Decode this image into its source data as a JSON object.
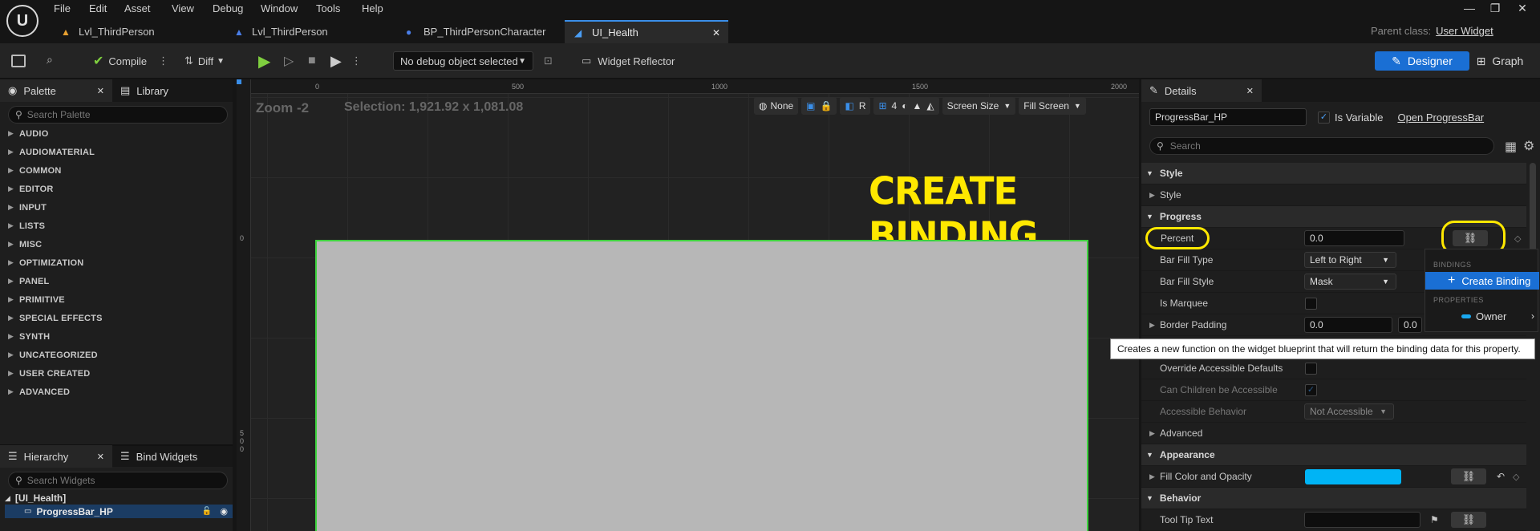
{
  "menu": [
    "File",
    "Edit",
    "Asset",
    "View",
    "Debug",
    "Window",
    "Tools",
    "Help"
  ],
  "tabs": [
    {
      "label": "Lvl_ThirdPerson"
    },
    {
      "label": "Lvl_ThirdPerson"
    },
    {
      "label": "BP_ThirdPersonCharacter"
    },
    {
      "label": "UI_Health"
    }
  ],
  "parent_class": {
    "label": "Parent class:",
    "value": "User Widget"
  },
  "toolbar": {
    "compile": "Compile",
    "diff": "Diff",
    "debug_object": "No debug object selected",
    "widget_reflector": "Widget Reflector",
    "designer": "Designer",
    "graph": "Graph"
  },
  "left_panel": {
    "palette_tab": "Palette",
    "library_tab": "Library",
    "search_placeholder": "Search Palette",
    "categories": [
      "AUDIO",
      "AUDIOMATERIAL",
      "COMMON",
      "EDITOR",
      "INPUT",
      "LISTS",
      "MISC",
      "OPTIMIZATION",
      "PANEL",
      "PRIMITIVE",
      "SPECIAL EFFECTS",
      "SYNTH",
      "UNCATEGORIZED",
      "USER CREATED",
      "ADVANCED"
    ],
    "hierarchy_tab": "Hierarchy",
    "bind_widgets_tab": "Bind Widgets",
    "hierarchy_search_placeholder": "Search Widgets",
    "root": "[UI_Health]",
    "child": "ProgressBar_HP"
  },
  "viewport": {
    "zoom": "Zoom -2",
    "selection": "Selection: 1,921.92 x 1,081.08",
    "ruler_x": [
      "0",
      "500",
      "1000",
      "1500",
      "2000"
    ],
    "ruler_y": [
      "0",
      "5",
      "0",
      "0"
    ],
    "none": "None",
    "r": "R",
    "grid_count": "4",
    "screen_size": "Screen Size",
    "fill_screen": "Fill Screen",
    "overlay": "CREATE BINDING",
    "accent": "#ffe800"
  },
  "details": {
    "tab": "Details",
    "name_value": "ProgressBar_HP",
    "is_variable": "Is Variable",
    "open_link": "Open ProgressBar",
    "search_placeholder": "Search",
    "sections": {
      "style": "Style",
      "progress": "Progress",
      "appearance": "Appearance",
      "behavior": "Behavior"
    },
    "props": {
      "style": "Style",
      "percent": "Percent",
      "percent_value": "0.0",
      "bar_fill_type": "Bar Fill Type",
      "bar_fill_type_value": "Left to Right",
      "bar_fill_style": "Bar Fill Style",
      "bar_fill_style_value": "Mask",
      "is_marquee": "Is Marquee",
      "border_padding": "Border Padding",
      "border_padding_x": "0.0",
      "border_padding_y": "0.0",
      "override_accessible": "Override Accessible Defaults",
      "can_children": "Can Children be Accessible",
      "accessible_behavior": "Accessible Behavior",
      "accessible_behavior_value": "Not Accessible",
      "advanced": "Advanced",
      "fill_color": "Fill Color and Opacity",
      "fill_color_hex": "#00b4f5",
      "tool_tip": "Tool Tip Text"
    }
  },
  "binding_menu": {
    "bindings_header": "BINDINGS",
    "create_binding": "Create Binding",
    "properties_header": "PROPERTIES",
    "owner": "Owner"
  },
  "tooltip": "Creates a new function on the widget blueprint that will return the binding data for this property."
}
